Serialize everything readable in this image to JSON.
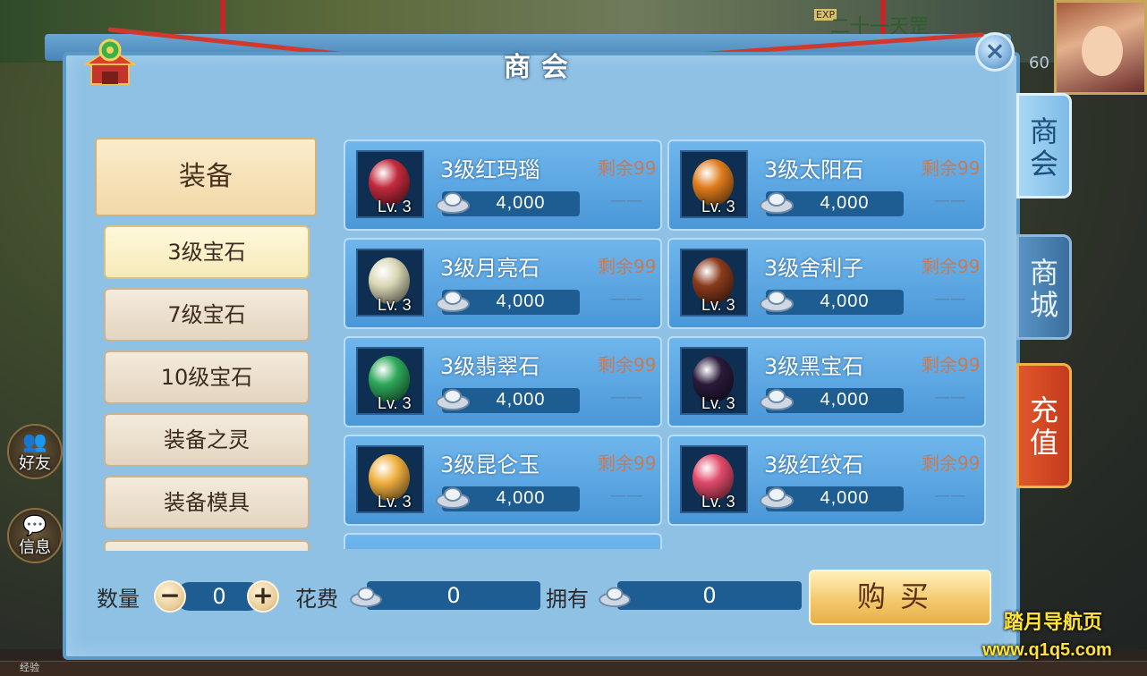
{
  "window": {
    "title": "商会",
    "close_label": "×"
  },
  "background": {
    "top_name": "二十一天罡",
    "exp_badge": "EXP",
    "hp_number": "60",
    "exp_label": "经验"
  },
  "side_buttons": [
    {
      "label": "好友",
      "icon": "friends-icon"
    },
    {
      "label": "信息",
      "icon": "chat-icon"
    }
  ],
  "categories": {
    "main": "装备",
    "sub": [
      "3级宝石",
      "7级宝石",
      "10级宝石",
      "装备之灵",
      "装备模具"
    ],
    "active_index": 0
  },
  "items": [
    {
      "name": "3级红玛瑙",
      "stock": "剩余99",
      "price": "4,000",
      "level": "Lv. 3",
      "dash": "——",
      "color": "#c22a3d"
    },
    {
      "name": "3级太阳石",
      "stock": "剩余99",
      "price": "4,000",
      "level": "Lv. 3",
      "dash": "——",
      "color": "#e07d1d"
    },
    {
      "name": "3级月亮石",
      "stock": "剩余99",
      "price": "4,000",
      "level": "Lv. 3",
      "dash": "——",
      "color": "#d9d6b4"
    },
    {
      "name": "3级舍利子",
      "stock": "剩余99",
      "price": "4,000",
      "level": "Lv. 3",
      "dash": "——",
      "color": "#8a3a1c"
    },
    {
      "name": "3级翡翠石",
      "stock": "剩余99",
      "price": "4,000",
      "level": "Lv. 3",
      "dash": "——",
      "color": "#2ea85a"
    },
    {
      "name": "3级黑宝石",
      "stock": "剩余99",
      "price": "4,000",
      "level": "Lv. 3",
      "dash": "——",
      "color": "#2a1a3a"
    },
    {
      "name": "3级昆仑玉",
      "stock": "剩余99",
      "price": "4,000",
      "level": "Lv. 3",
      "dash": "——",
      "color": "#f0b040"
    },
    {
      "name": "3级红纹石",
      "stock": "剩余99",
      "price": "4,000",
      "level": "Lv. 3",
      "dash": "——",
      "color": "#e04a6a"
    }
  ],
  "footer": {
    "quantity_label": "数量",
    "quantity_value": "0",
    "minus": "−",
    "plus": "+",
    "cost_label": "花费",
    "cost_value": "0",
    "own_label": "拥有",
    "own_value": "0",
    "buy_label": "购买"
  },
  "tabs": [
    {
      "label": "商\n会",
      "active": true
    },
    {
      "label": "商\n城",
      "active": false
    },
    {
      "label": "充\n值",
      "active": false
    }
  ],
  "watermark": {
    "line1": "踏月导航页",
    "line2": "www.q1q5.com"
  },
  "colors": {
    "panel": "#8fc1e5",
    "item": "#4a97d8",
    "buy": "#f3c669",
    "recharge": "#c53a1d",
    "stock_text": "#c37b5a"
  }
}
